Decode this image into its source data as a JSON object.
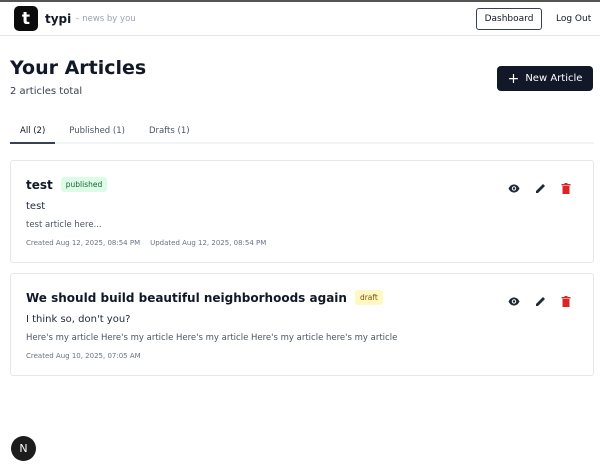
{
  "header": {
    "logo_letter": "t",
    "brand": "typi",
    "tagline": "– news by you",
    "dashboard_label": "Dashboard",
    "logout_label": "Log Out"
  },
  "page": {
    "title": "Your Articles",
    "count_text": "2 articles total",
    "new_article_label": "New Article"
  },
  "tabs": [
    {
      "label": "All (2)",
      "active": true
    },
    {
      "label": "Published (1)"
    },
    {
      "label": "Drafts (1)"
    }
  ],
  "articles": [
    {
      "title": "test",
      "status": "published",
      "subtitle": "test",
      "excerpt": "test article here...",
      "created": "Created Aug 12, 2025, 08:54 PM",
      "updated": "Updated Aug 12, 2025, 08:54 PM"
    },
    {
      "title": "We should build beautiful neighborhoods again",
      "status": "draft",
      "subtitle": "I think so, don't you?",
      "excerpt": "Here's my article Here's my article Here's my article Here's my article here's my article",
      "created": "Created Aug 10, 2025, 07:05 AM"
    }
  ],
  "dev_badge": "N",
  "colors": {
    "primary": "#111827",
    "delete": "#dc2626",
    "published_bg": "#dcfce7",
    "draft_bg": "#fef9c3"
  }
}
